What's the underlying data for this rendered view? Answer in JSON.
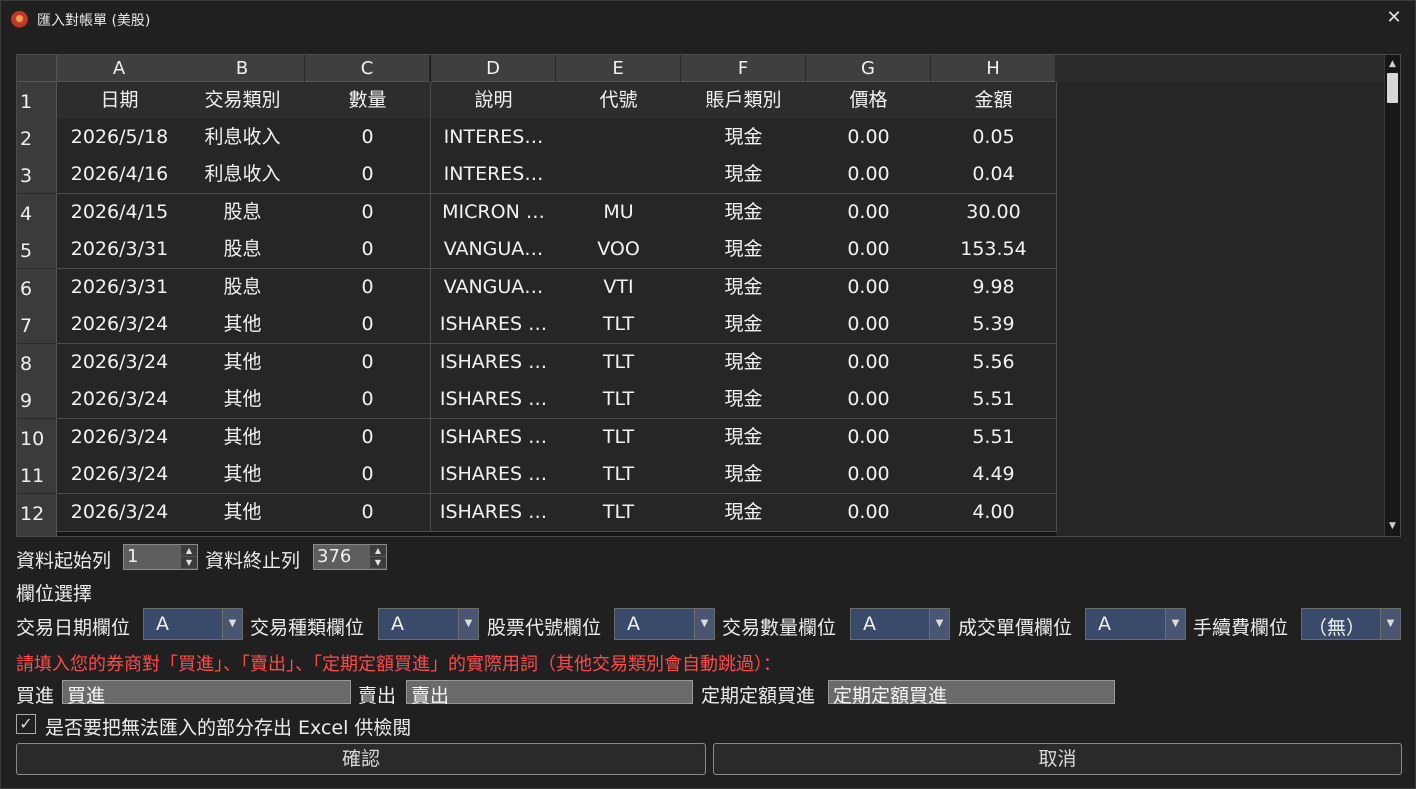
{
  "window": {
    "title": "匯入對帳單 (美股)",
    "close_glyph": "✕"
  },
  "grid": {
    "columns": [
      "A",
      "B",
      "C",
      "D",
      "E",
      "F",
      "G",
      "H"
    ],
    "header_row": [
      "日期",
      "交易類別",
      "數量",
      "說明",
      "代號",
      "賬戶類別",
      "價格",
      "金額"
    ],
    "rows": [
      {
        "num": "1"
      },
      {
        "num": "2",
        "cells": [
          "2026/5/18",
          "利息收入",
          "0",
          "INTERES…",
          "",
          "現金",
          "0.00",
          "0.05"
        ]
      },
      {
        "num": "3",
        "cells": [
          "2026/4/16",
          "利息收入",
          "0",
          "INTERES…",
          "",
          "現金",
          "0.00",
          "0.04"
        ]
      },
      {
        "num": "4",
        "cells": [
          "2026/4/15",
          "股息",
          "0",
          "MICRON …",
          "MU",
          "現金",
          "0.00",
          "30.00"
        ]
      },
      {
        "num": "5",
        "cells": [
          "2026/3/31",
          "股息",
          "0",
          "VANGUA…",
          "VOO",
          "現金",
          "0.00",
          "153.54"
        ]
      },
      {
        "num": "6",
        "cells": [
          "2026/3/31",
          "股息",
          "0",
          "VANGUA…",
          "VTI",
          "現金",
          "0.00",
          "9.98"
        ]
      },
      {
        "num": "7",
        "cells": [
          "2026/3/24",
          "其他",
          "0",
          "ISHARES …",
          "TLT",
          "現金",
          "0.00",
          "5.39"
        ]
      },
      {
        "num": "8",
        "cells": [
          "2026/3/24",
          "其他",
          "0",
          "ISHARES …",
          "TLT",
          "現金",
          "0.00",
          "5.56"
        ]
      },
      {
        "num": "9",
        "cells": [
          "2026/3/24",
          "其他",
          "0",
          "ISHARES …",
          "TLT",
          "現金",
          "0.00",
          "5.51"
        ]
      },
      {
        "num": "10",
        "cells": [
          "2026/3/24",
          "其他",
          "0",
          "ISHARES …",
          "TLT",
          "現金",
          "0.00",
          "5.51"
        ]
      },
      {
        "num": "11",
        "cells": [
          "2026/3/24",
          "其他",
          "0",
          "ISHARES …",
          "TLT",
          "現金",
          "0.00",
          "4.49"
        ]
      },
      {
        "num": "12",
        "cells": [
          "2026/3/24",
          "其他",
          "0",
          "ISHARES …",
          "TLT",
          "現金",
          "0.00",
          "4.00"
        ]
      }
    ]
  },
  "range": {
    "start_label": "資料起始列",
    "start_value": "1",
    "end_label": "資料終止列",
    "end_value": "376"
  },
  "column_select": {
    "heading": "欄位選擇",
    "fields": [
      {
        "label": "交易日期欄位",
        "value": "A"
      },
      {
        "label": "交易種類欄位",
        "value": "A"
      },
      {
        "label": "股票代號欄位",
        "value": "A"
      },
      {
        "label": "交易數量欄位",
        "value": "A"
      },
      {
        "label": "成交單價欄位",
        "value": "A"
      },
      {
        "label": "手續費欄位",
        "value": "（無）"
      }
    ]
  },
  "terms": {
    "instruction": "請填入您的券商對「買進」、「賣出」、「定期定額買進」的實際用詞（其他交易類別會自動跳過）：",
    "buy_label": "買進",
    "buy_value": "買進",
    "sell_label": "賣出",
    "sell_value": "賣出",
    "dca_label": "定期定額買進",
    "dca_value": "定期定額買進"
  },
  "export_option": {
    "checked_glyph": "✓",
    "label": "是否要把無法匯入的部分存出 Excel 供檢閱"
  },
  "buttons": {
    "confirm": "確認",
    "cancel": "取消"
  },
  "colors": {
    "instruction_text": "#ff4a4a",
    "combo_bg": "#3a4a6a"
  }
}
